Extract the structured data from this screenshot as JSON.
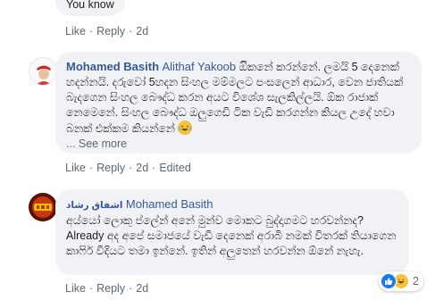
{
  "comment0": {
    "text": "You know",
    "actions": {
      "like": "Like",
      "reply": "Reply",
      "time": "2d"
    }
  },
  "comment1": {
    "author": "Mohamed Basith",
    "tagged": "Alithaf Yakoob",
    "text_line1": " ඔිකනේ කරන්නේ. ලමයි 5",
    "text_rest": "දෙනෙක් හදන්නයි. දරුවෝ 5හදන සිංහල මම්මලට පංසලෙන් ආධාර, වෙන ජාතියක් බැදගෙන සිංහල බෞද්ධ කරන අයට විශේශ සැලකිල්ලයි. ඕක රාජාක් නෙමෙනේ. සිංහල බෞද්ධ ඔලුගෙඩි ටික වැඩි කරගන්න කියල උදේ හවා බනක් එක්කම කියන්නේ",
    "see_more": "... See more",
    "actions": {
      "like": "Like",
      "reply": "Reply",
      "time": "2d",
      "edited": "Edited"
    },
    "emoji": "laugh-cry"
  },
  "comment2": {
    "author": "اشفاق رشاد",
    "tagged": "Mohamed Basith",
    "text": "අය්යෝ ලොකු ප්ලේන් අනේ මුන්ව මොකට බුද්දාගමට හරවන්නද?\nAlready අද අපේ සමාජයේ වැඩි දෙනෙක් අරාබි නමක් විතරක් තියාගෙන කාෆිර් විදියට තමා ඉන්නේ. ඉතින් අලුතෙන් හරවන්න ඕනේ නැහැ.",
    "actions": {
      "like": "Like",
      "reply": "Reply",
      "time": "2d"
    },
    "reaction_count": "2",
    "reaction_icons": [
      "like-icon",
      "laugh-icon"
    ]
  },
  "colors": {
    "bubble": "#f0f2f5",
    "link": "#385898",
    "meta": "#606770",
    "like_blue": "#1877f2",
    "emoji_yellow": "#f7c23a"
  }
}
